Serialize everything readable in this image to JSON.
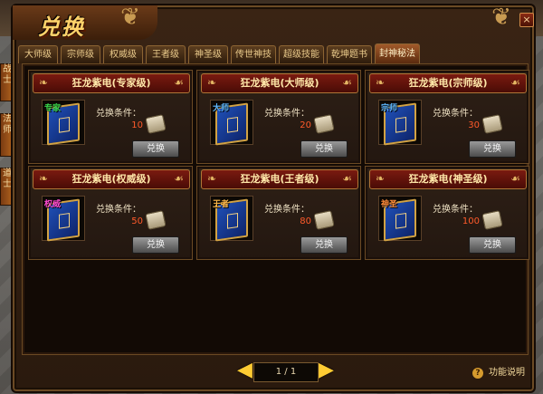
{
  "window": {
    "title": "兑换",
    "close_label": "×"
  },
  "side_tabs": [
    {
      "label": "战\n士"
    },
    {
      "label": "法\n师"
    },
    {
      "label": "道\n士"
    }
  ],
  "tabs": [
    {
      "label": "大师级",
      "active": false
    },
    {
      "label": "宗师级",
      "active": false
    },
    {
      "label": "权威级",
      "active": false
    },
    {
      "label": "王者级",
      "active": false
    },
    {
      "label": "神圣级",
      "active": false
    },
    {
      "label": "传世神技",
      "active": false
    },
    {
      "label": "超级技能",
      "active": false
    },
    {
      "label": "乾坤题书",
      "active": false
    },
    {
      "label": "封神秘法",
      "active": true
    }
  ],
  "cards": [
    {
      "title": "狂龙紫电(专家级)",
      "badge": "专家",
      "badge_color": "#3ad54a",
      "condition_label": "兑换条件：",
      "amount": "10",
      "button_label": "兑换"
    },
    {
      "title": "狂龙紫电(大师级)",
      "badge": "大师",
      "badge_color": "#5fb8ff",
      "condition_label": "兑换条件：",
      "amount": "20",
      "button_label": "兑换"
    },
    {
      "title": "狂龙紫电(宗师级)",
      "badge": "宗师",
      "badge_color": "#5fb8ff",
      "condition_label": "兑换条件：",
      "amount": "30",
      "button_label": "兑换"
    },
    {
      "title": "狂龙紫电(权威级)",
      "badge": "权威",
      "badge_color": "#ff4ad0",
      "condition_label": "兑换条件：",
      "amount": "50",
      "button_label": "兑换"
    },
    {
      "title": "狂龙紫电(王者级)",
      "badge": "王者",
      "badge_color": "#ffb84a",
      "condition_label": "兑换条件：",
      "amount": "80",
      "button_label": "兑换"
    },
    {
      "title": "狂龙紫电(神圣级)",
      "badge": "神圣",
      "badge_color": "#ff8c3a",
      "condition_label": "兑换条件：",
      "amount": "100",
      "button_label": "兑换"
    }
  ],
  "pager": {
    "text": "1 / 1"
  },
  "help": {
    "label": "功能说明",
    "icon": "question-icon"
  }
}
